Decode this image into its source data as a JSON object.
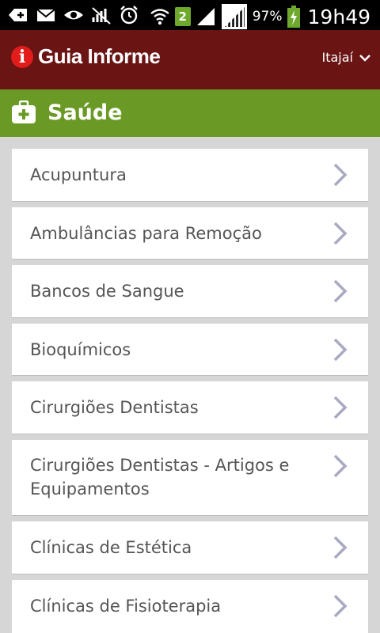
{
  "status_bar": {
    "battery": "97%",
    "time": "19h49",
    "sim_badge": "2"
  },
  "header": {
    "logo_letter": "i",
    "logo_text": "Guia Informe",
    "city": "Itajaí"
  },
  "section": {
    "title": "Saúde"
  },
  "list": {
    "items": [
      {
        "label": "Acupuntura"
      },
      {
        "label": "Ambulâncias para Remoção"
      },
      {
        "label": "Bancos de Sangue"
      },
      {
        "label": "Bioquímicos"
      },
      {
        "label": "Cirurgiões Dentistas"
      },
      {
        "label": "Cirurgiões Dentistas - Artigos e Equipamentos"
      },
      {
        "label": "Clínicas de Estética"
      },
      {
        "label": "Clínicas de Fisioterapia"
      }
    ]
  },
  "colors": {
    "header_bg": "#6a1414",
    "section_bg": "#6a9a25",
    "chevron": "#a9a9c2"
  }
}
